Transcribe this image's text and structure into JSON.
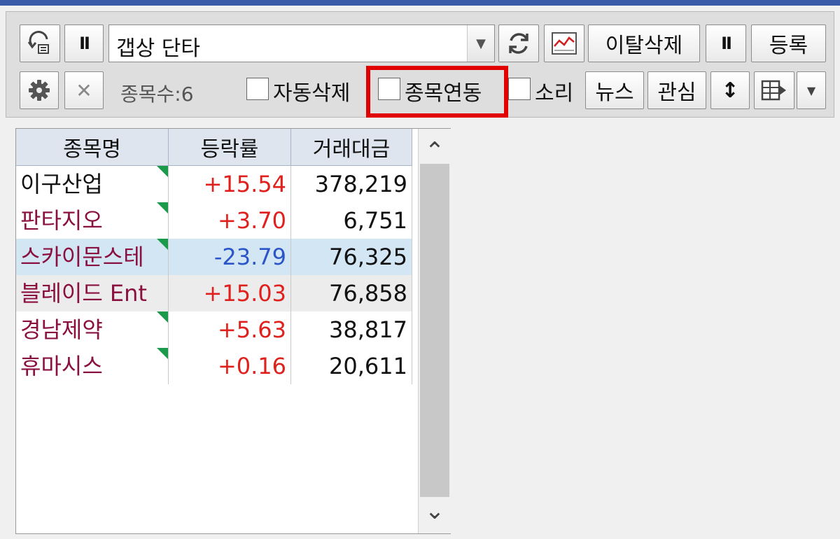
{
  "toolbar": {
    "condition_combo": "갭상 단타",
    "deviation_delete_label": "이탈삭제",
    "register_label": "등록",
    "pause_glyph": "II",
    "news_label": "뉴스",
    "watch_label": "관심",
    "item_count": "종목수:6",
    "auto_delete_label": "자동삭제",
    "item_link_label": "종목연동",
    "sound_label": "소리",
    "sort_glyph": "↕",
    "close_glyph": "✕",
    "dropdown_glyph": "▼"
  },
  "table": {
    "columns": [
      "종목명",
      "등락률",
      "거래대금"
    ],
    "rows": [
      {
        "name": "이구산업",
        "rate": "+15.54",
        "value": "378,219"
      },
      {
        "name": "판타지오",
        "rate": "+3.70",
        "value": "6,751"
      },
      {
        "name": "스카이문스테",
        "rate": "-23.79",
        "value": "76,325"
      },
      {
        "name": "블레이드 Ent",
        "rate": "+15.03",
        "value": "76,858"
      },
      {
        "name": "경남제약",
        "rate": "+5.63",
        "value": "38,817"
      },
      {
        "name": "휴마시스",
        "rate": "+0.16",
        "value": "20,611"
      }
    ]
  },
  "scroll": {
    "up_glyph": "⌃",
    "down_glyph": "⌄"
  },
  "colors": {
    "rise": "#e0201c",
    "fall": "#2b55c8",
    "stock_name": "#8a1040",
    "selected_row": "#d3e6f4",
    "hover_row": "#ececec",
    "highlight_box": "#e00000"
  }
}
